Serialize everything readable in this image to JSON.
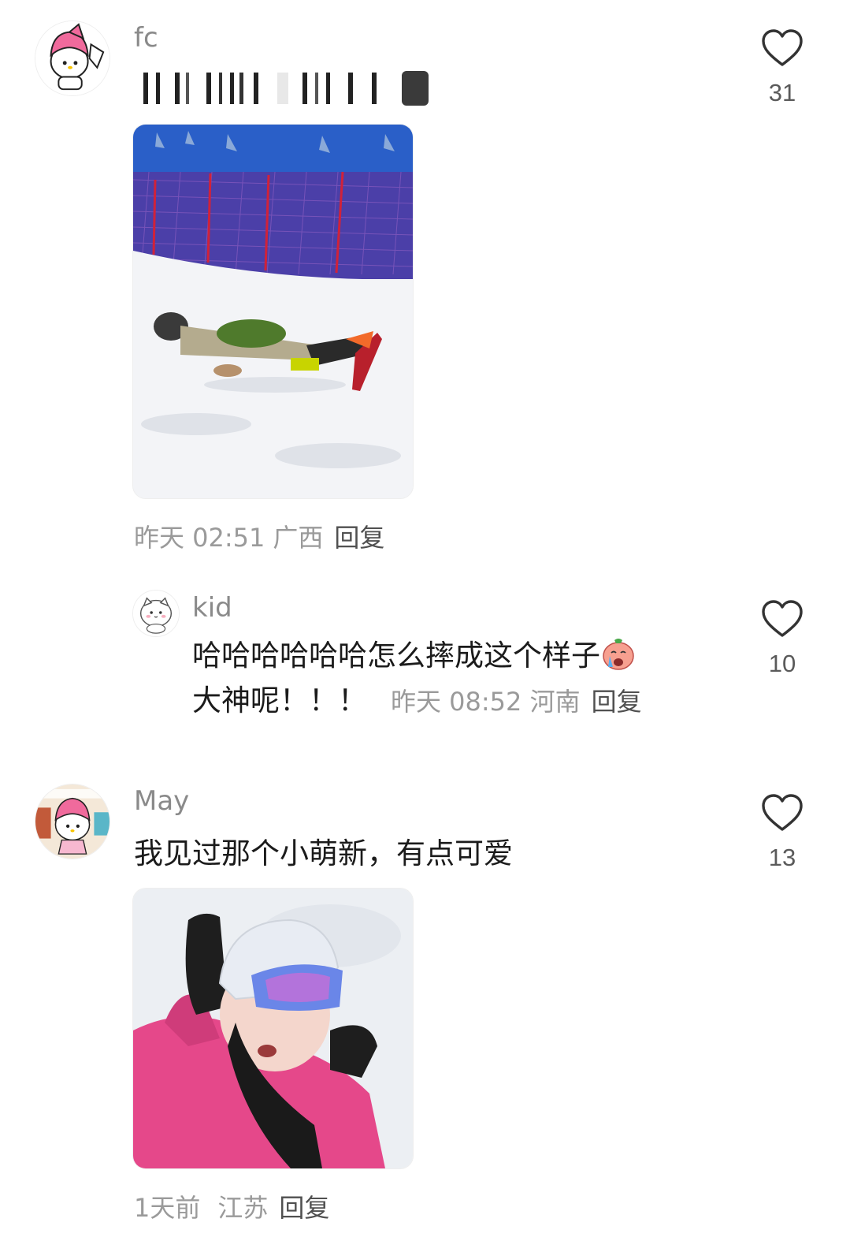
{
  "comments": [
    {
      "username": "fc",
      "text": "",
      "time": "昨天 02:51",
      "location": "广西",
      "reply_label": "回复",
      "likes": "31"
    },
    {
      "username": "kid",
      "text_line1": "哈哈哈哈哈哈怎么摔成这个样子",
      "text_line2": "大神呢！！！",
      "time": "昨天 08:52",
      "location": "河南",
      "reply_label": "回复",
      "likes": "10"
    },
    {
      "username": "May",
      "text": "我见过那个小萌新，有点可爱",
      "time": "1天前",
      "location": "江苏",
      "reply_label": "回复",
      "likes": "13"
    }
  ],
  "icons": {
    "like": "heart-outline-icon",
    "emoji": "crying-face-emoji"
  },
  "colors": {
    "username": "#8a8a8a",
    "meta": "#9a9a9a",
    "reply": "#505050",
    "text": "#1b1b1b"
  }
}
